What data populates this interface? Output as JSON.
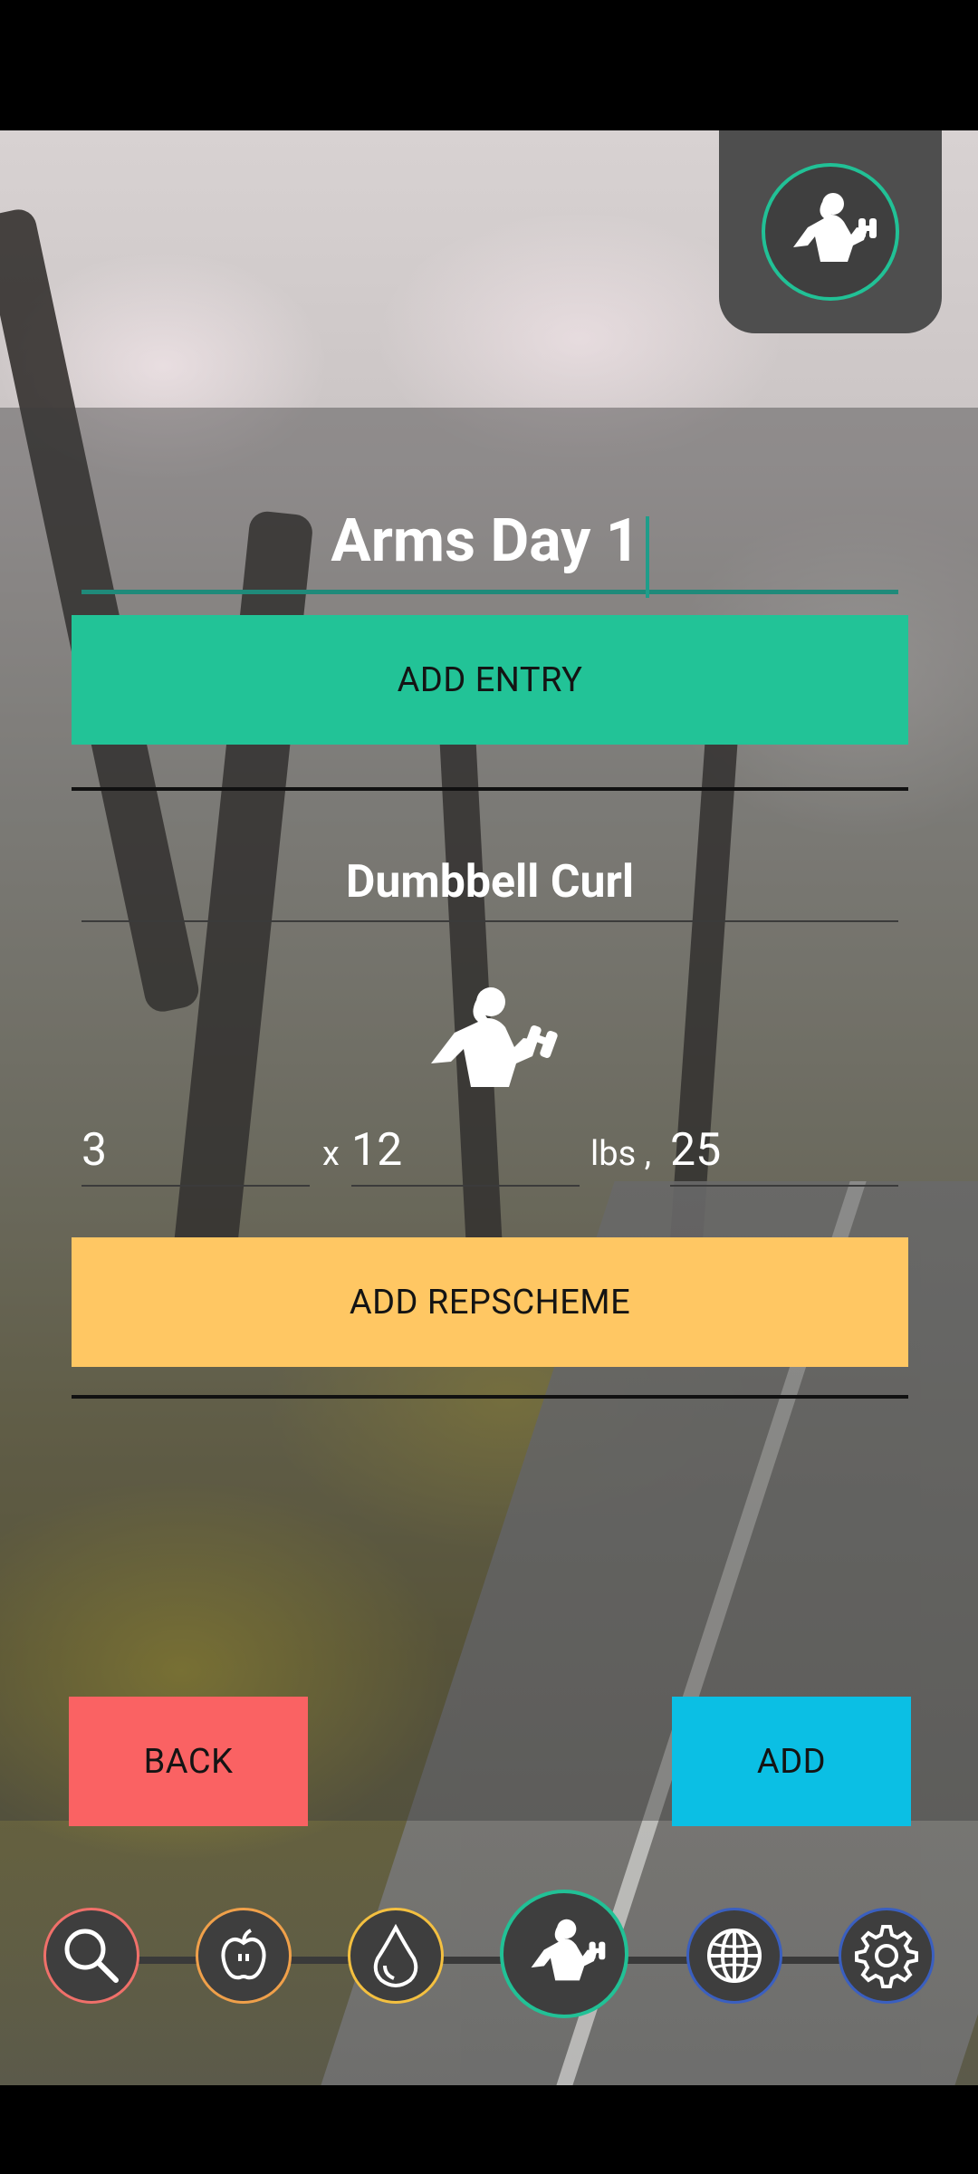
{
  "header": {
    "title": "Arms Day 1"
  },
  "actions": {
    "add_entry_label": "ADD ENTRY",
    "add_repscheme_label": "ADD REPSCHEME",
    "back_label": "BACK",
    "add_label": "ADD"
  },
  "entry": {
    "exercise_name": "Dumbbell Curl",
    "sets": "3",
    "sets_separator": "x",
    "reps": "12",
    "weight_unit_separator": "lbs ,",
    "weight": "25"
  },
  "icons": {
    "corner_logo": "bodybuilder-icon",
    "exercise": "bodybuilder-icon",
    "nav": [
      "search-icon",
      "apple-icon",
      "water-drop-icon",
      "bodybuilder-icon",
      "globe-icon",
      "gear-icon"
    ]
  },
  "colors": {
    "accent_green": "#22c397",
    "repscheme_yellow": "#ffc763",
    "back_red": "#fa6263",
    "add_blue": "#0bbfe4",
    "nav_search_ring": "#f0706a",
    "nav_apple_ring": "#f0a04a",
    "nav_drop_ring": "#f4c040",
    "nav_active_ring": "#21c196",
    "nav_globe_ring": "#3a5fc0",
    "nav_gear_ring": "#3a5fc0"
  }
}
